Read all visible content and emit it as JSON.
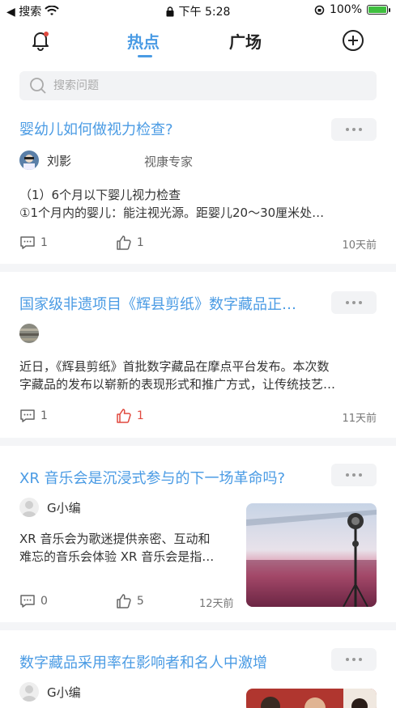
{
  "status_bar": {
    "back_app": "◀ 搜索",
    "time": "下午 5:28",
    "battery": "100%"
  },
  "nav": {
    "tab_hot": "热点",
    "tab_square": "广场"
  },
  "search": {
    "placeholder": "搜索问题"
  },
  "cards": [
    {
      "title": "婴幼儿如何做视力检查?",
      "author": "刘影",
      "role": "视康专家",
      "excerpt_line1": "（1）6个月以下婴儿视力检查",
      "excerpt_line2": "①1个月内的婴儿：能注视光源。距婴儿20～30厘米处…",
      "comments": "1",
      "likes": "1",
      "time": "10天前"
    },
    {
      "title": "国家级非遗项目《辉县剪纸》数字藏品正…",
      "author": "",
      "excerpt_line1": "近日，《辉县剪纸》首批数字藏品在摩点平台发布。本次数",
      "excerpt_line2": "字藏品的发布以崭新的表现形式和推广方式，让传统技艺…",
      "comments": "1",
      "likes": "1",
      "time": "11天前"
    },
    {
      "title": "XR 音乐会是沉浸式参与的下一场革命吗?",
      "author": "G小编",
      "excerpt_line1": "XR 音乐会为歌迷提供亲密、互动和",
      "excerpt_line2": "难忘的音乐会体验 XR 音乐会是指…",
      "comments": "0",
      "likes": "5",
      "time": "12天前"
    },
    {
      "title": "数字藏品采用率在影响者和名人中激增",
      "author": "G小编"
    }
  ],
  "colors": {
    "accent": "#4a9be4",
    "liked": "#e0493e",
    "divider": "#f4f5f7"
  }
}
